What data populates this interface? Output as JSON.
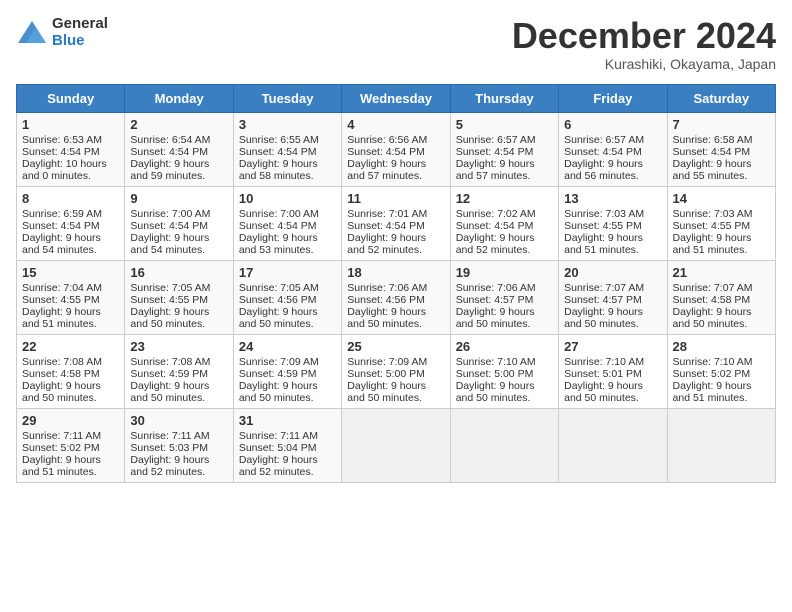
{
  "logo": {
    "general": "General",
    "blue": "Blue"
  },
  "title": "December 2024",
  "subtitle": "Kurashiki, Okayama, Japan",
  "weekdays": [
    "Sunday",
    "Monday",
    "Tuesday",
    "Wednesday",
    "Thursday",
    "Friday",
    "Saturday"
  ],
  "weeks": [
    [
      {
        "day": "1",
        "lines": [
          "Sunrise: 6:53 AM",
          "Sunset: 4:54 PM",
          "Daylight: 10 hours",
          "and 0 minutes."
        ]
      },
      {
        "day": "2",
        "lines": [
          "Sunrise: 6:54 AM",
          "Sunset: 4:54 PM",
          "Daylight: 9 hours",
          "and 59 minutes."
        ]
      },
      {
        "day": "3",
        "lines": [
          "Sunrise: 6:55 AM",
          "Sunset: 4:54 PM",
          "Daylight: 9 hours",
          "and 58 minutes."
        ]
      },
      {
        "day": "4",
        "lines": [
          "Sunrise: 6:56 AM",
          "Sunset: 4:54 PM",
          "Daylight: 9 hours",
          "and 57 minutes."
        ]
      },
      {
        "day": "5",
        "lines": [
          "Sunrise: 6:57 AM",
          "Sunset: 4:54 PM",
          "Daylight: 9 hours",
          "and 57 minutes."
        ]
      },
      {
        "day": "6",
        "lines": [
          "Sunrise: 6:57 AM",
          "Sunset: 4:54 PM",
          "Daylight: 9 hours",
          "and 56 minutes."
        ]
      },
      {
        "day": "7",
        "lines": [
          "Sunrise: 6:58 AM",
          "Sunset: 4:54 PM",
          "Daylight: 9 hours",
          "and 55 minutes."
        ]
      }
    ],
    [
      {
        "day": "8",
        "lines": [
          "Sunrise: 6:59 AM",
          "Sunset: 4:54 PM",
          "Daylight: 9 hours",
          "and 54 minutes."
        ]
      },
      {
        "day": "9",
        "lines": [
          "Sunrise: 7:00 AM",
          "Sunset: 4:54 PM",
          "Daylight: 9 hours",
          "and 54 minutes."
        ]
      },
      {
        "day": "10",
        "lines": [
          "Sunrise: 7:00 AM",
          "Sunset: 4:54 PM",
          "Daylight: 9 hours",
          "and 53 minutes."
        ]
      },
      {
        "day": "11",
        "lines": [
          "Sunrise: 7:01 AM",
          "Sunset: 4:54 PM",
          "Daylight: 9 hours",
          "and 52 minutes."
        ]
      },
      {
        "day": "12",
        "lines": [
          "Sunrise: 7:02 AM",
          "Sunset: 4:54 PM",
          "Daylight: 9 hours",
          "and 52 minutes."
        ]
      },
      {
        "day": "13",
        "lines": [
          "Sunrise: 7:03 AM",
          "Sunset: 4:55 PM",
          "Daylight: 9 hours",
          "and 51 minutes."
        ]
      },
      {
        "day": "14",
        "lines": [
          "Sunrise: 7:03 AM",
          "Sunset: 4:55 PM",
          "Daylight: 9 hours",
          "and 51 minutes."
        ]
      }
    ],
    [
      {
        "day": "15",
        "lines": [
          "Sunrise: 7:04 AM",
          "Sunset: 4:55 PM",
          "Daylight: 9 hours",
          "and 51 minutes."
        ]
      },
      {
        "day": "16",
        "lines": [
          "Sunrise: 7:05 AM",
          "Sunset: 4:55 PM",
          "Daylight: 9 hours",
          "and 50 minutes."
        ]
      },
      {
        "day": "17",
        "lines": [
          "Sunrise: 7:05 AM",
          "Sunset: 4:56 PM",
          "Daylight: 9 hours",
          "and 50 minutes."
        ]
      },
      {
        "day": "18",
        "lines": [
          "Sunrise: 7:06 AM",
          "Sunset: 4:56 PM",
          "Daylight: 9 hours",
          "and 50 minutes."
        ]
      },
      {
        "day": "19",
        "lines": [
          "Sunrise: 7:06 AM",
          "Sunset: 4:57 PM",
          "Daylight: 9 hours",
          "and 50 minutes."
        ]
      },
      {
        "day": "20",
        "lines": [
          "Sunrise: 7:07 AM",
          "Sunset: 4:57 PM",
          "Daylight: 9 hours",
          "and 50 minutes."
        ]
      },
      {
        "day": "21",
        "lines": [
          "Sunrise: 7:07 AM",
          "Sunset: 4:58 PM",
          "Daylight: 9 hours",
          "and 50 minutes."
        ]
      }
    ],
    [
      {
        "day": "22",
        "lines": [
          "Sunrise: 7:08 AM",
          "Sunset: 4:58 PM",
          "Daylight: 9 hours",
          "and 50 minutes."
        ]
      },
      {
        "day": "23",
        "lines": [
          "Sunrise: 7:08 AM",
          "Sunset: 4:59 PM",
          "Daylight: 9 hours",
          "and 50 minutes."
        ]
      },
      {
        "day": "24",
        "lines": [
          "Sunrise: 7:09 AM",
          "Sunset: 4:59 PM",
          "Daylight: 9 hours",
          "and 50 minutes."
        ]
      },
      {
        "day": "25",
        "lines": [
          "Sunrise: 7:09 AM",
          "Sunset: 5:00 PM",
          "Daylight: 9 hours",
          "and 50 minutes."
        ]
      },
      {
        "day": "26",
        "lines": [
          "Sunrise: 7:10 AM",
          "Sunset: 5:00 PM",
          "Daylight: 9 hours",
          "and 50 minutes."
        ]
      },
      {
        "day": "27",
        "lines": [
          "Sunrise: 7:10 AM",
          "Sunset: 5:01 PM",
          "Daylight: 9 hours",
          "and 50 minutes."
        ]
      },
      {
        "day": "28",
        "lines": [
          "Sunrise: 7:10 AM",
          "Sunset: 5:02 PM",
          "Daylight: 9 hours",
          "and 51 minutes."
        ]
      }
    ],
    [
      {
        "day": "29",
        "lines": [
          "Sunrise: 7:11 AM",
          "Sunset: 5:02 PM",
          "Daylight: 9 hours",
          "and 51 minutes."
        ]
      },
      {
        "day": "30",
        "lines": [
          "Sunrise: 7:11 AM",
          "Sunset: 5:03 PM",
          "Daylight: 9 hours",
          "and 52 minutes."
        ]
      },
      {
        "day": "31",
        "lines": [
          "Sunrise: 7:11 AM",
          "Sunset: 5:04 PM",
          "Daylight: 9 hours",
          "and 52 minutes."
        ]
      },
      null,
      null,
      null,
      null
    ]
  ]
}
